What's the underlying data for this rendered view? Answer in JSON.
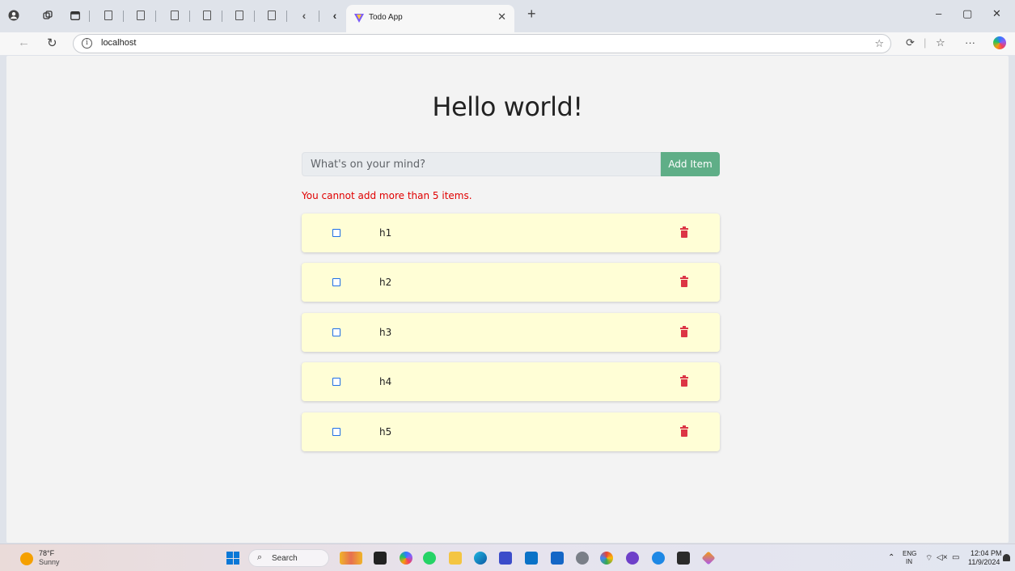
{
  "browser": {
    "active_tab": {
      "title": "Todo App",
      "close_icon": "close-icon"
    },
    "new_tab_icon": "plus-icon",
    "url": "localhost",
    "window_controls": {
      "minimize": "–",
      "restore": "▢",
      "close": "✕"
    }
  },
  "app": {
    "heading": "Hello world!",
    "input_placeholder": "What's on your mind?",
    "add_button_label": "Add Item",
    "error_message": "You cannot add more than 5 items.",
    "todos": [
      {
        "text": "h1",
        "done": false
      },
      {
        "text": "h2",
        "done": false
      },
      {
        "text": "h3",
        "done": false
      },
      {
        "text": "h4",
        "done": false
      },
      {
        "text": "h5",
        "done": false
      }
    ],
    "colors": {
      "add_button": "#5fae87",
      "error": "#e00000",
      "todo_bg": "#fffed6",
      "checkbox": "#1f6fe5",
      "trash": "#dc3545"
    }
  },
  "taskbar": {
    "weather_temp": "78°F",
    "weather_condition": "Sunny",
    "search_label": "Search",
    "lang_top": "ENG",
    "lang_bottom": "IN",
    "time": "12:04 PM",
    "date": "11/9/2024"
  }
}
